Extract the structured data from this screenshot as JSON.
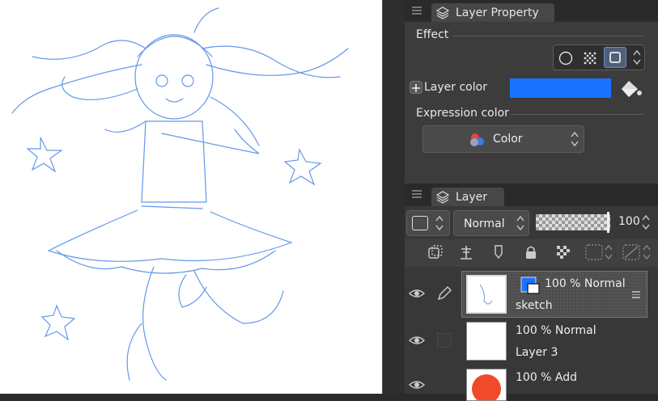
{
  "property_panel": {
    "tab_title": "Layer Property",
    "effect_label": "Effect",
    "effect_icons": [
      "circle-outline-icon",
      "halftone-icon",
      "border-effect-icon"
    ],
    "layer_color_label": "Layer color",
    "layer_color_value": "#1a73ff",
    "expression_color_label": "Expression color",
    "expression_color_value": "Color"
  },
  "layer_panel": {
    "tab_title": "Layer",
    "blend_mode": "Normal",
    "opacity": "100",
    "tool_icons": [
      "clip-icon",
      "reference-icon",
      "draft-icon",
      "lock-icon",
      "lock-transparent-icon",
      "mask-icon",
      "ruler-icon"
    ],
    "layers": [
      {
        "opacity_mode": "100 % Normal",
        "name": "sketch",
        "selected": true
      },
      {
        "opacity_mode": "100 % Normal",
        "name": "Layer 3",
        "selected": false
      },
      {
        "opacity_mode": "100 % Add",
        "name": "",
        "selected": false
      }
    ]
  },
  "colors": {
    "sketch_line": "#4a86e8",
    "layer_color": "#1a73ff",
    "panel_bg": "#3c3c3c",
    "selected_row": "#4d4d4d"
  }
}
